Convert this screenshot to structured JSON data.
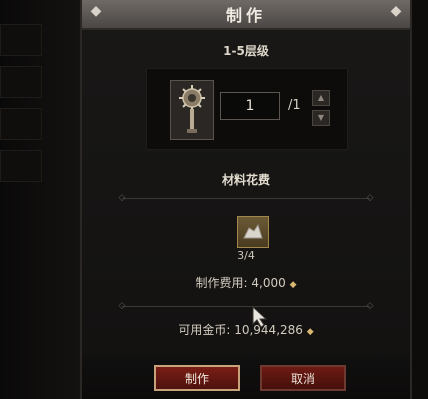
{
  "window": {
    "title": "制作"
  },
  "recipe": {
    "tier_label": "1-5层级",
    "item_icon": "mace-icon"
  },
  "quantity": {
    "value": "1",
    "max_label": "/1",
    "up_icon": "arrow-up-icon",
    "down_icon": "arrow-down-icon"
  },
  "materials": {
    "section_label": "材料花费",
    "items": [
      {
        "icon": "rock-material-icon",
        "count": "3/4"
      }
    ]
  },
  "cost": {
    "label": "制作费用:",
    "value": "4,000"
  },
  "gold": {
    "label": "可用金币:",
    "value": "10,944,286"
  },
  "buttons": {
    "craft": "制作",
    "cancel": "取消"
  },
  "colors": {
    "gold": "#d8b770",
    "button_red": "#7a1e16",
    "button_border": "#c8a27a"
  }
}
